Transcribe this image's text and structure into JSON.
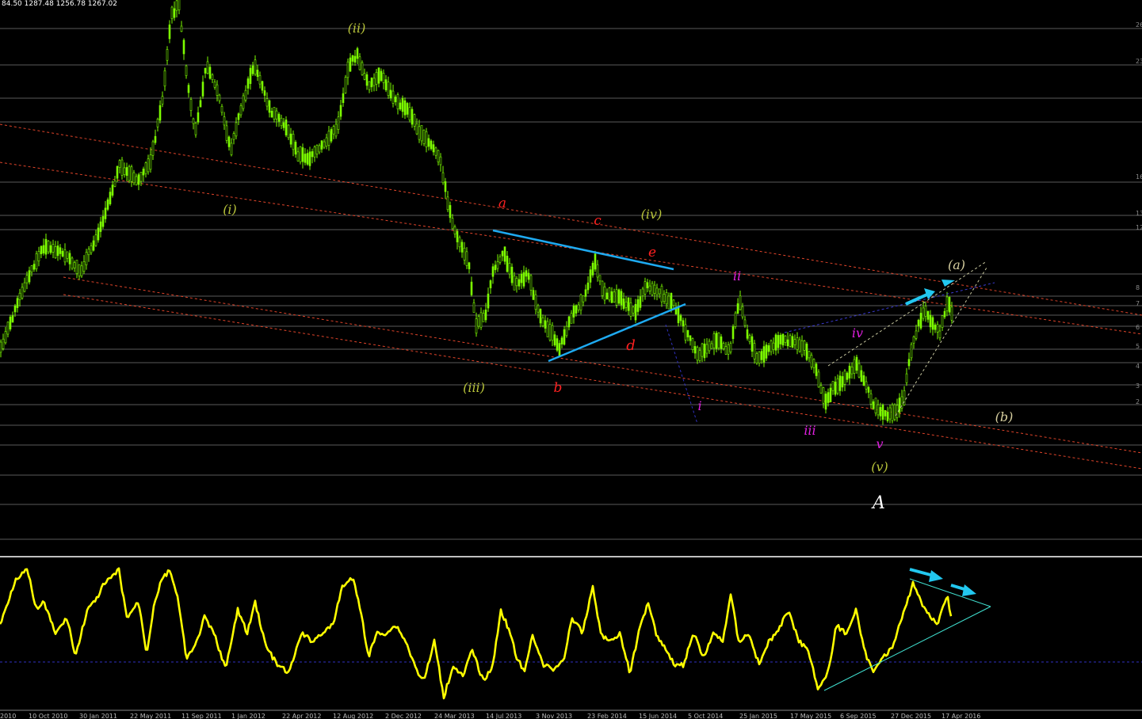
{
  "ohlc_readout": "84.50 1287.48 1256.78 1267.02",
  "colors": {
    "background": "#000000",
    "candle": "#7CFC00",
    "oscillator": "#FFFF00",
    "channel": "#E0442A",
    "trendline": "#1EAAF1",
    "wave_olive": "#B8C43A",
    "wave_red": "#FF2020",
    "wave_magenta": "#E020E0",
    "wave_tan": "#D8D0A0",
    "wave_white": "#FFFFFF"
  },
  "chart_data": [
    {
      "type": "candlestick",
      "title": "",
      "x_ticks": [
        "2010",
        "10 Oct 2010",
        "30 Jan 2011",
        "22 May 2011",
        "11 Sep 2011",
        "1 Jan 2012",
        "22 Apr 2012",
        "12 Aug 2012",
        "2 Dec 2012",
        "24 Mar 2013",
        "14 Jul 2013",
        "3 Nov 2013",
        "23 Feb 2014",
        "15 Jun 2014",
        "5 Oct 2014",
        "25 Jan 2015",
        "17 May 2015",
        "6 Sep 2015",
        "27 Dec 2015",
        "17 Apr 2016"
      ],
      "y_tick_labels": [
        "26",
        "23",
        "16",
        "13",
        "12",
        "8",
        "7",
        "6",
        "5",
        "4",
        "3",
        "2"
      ],
      "path_anchors": [
        [
          0,
          440
        ],
        [
          30,
          360
        ],
        [
          55,
          310
        ],
        [
          80,
          320
        ],
        [
          100,
          345
        ],
        [
          125,
          290
        ],
        [
          150,
          210
        ],
        [
          175,
          230
        ],
        [
          190,
          200
        ],
        [
          205,
          120
        ],
        [
          215,
          20
        ],
        [
          225,
          5
        ],
        [
          235,
          100
        ],
        [
          245,
          170
        ],
        [
          260,
          80
        ],
        [
          275,
          120
        ],
        [
          290,
          190
        ],
        [
          300,
          150
        ],
        [
          320,
          80
        ],
        [
          340,
          140
        ],
        [
          360,
          160
        ],
        [
          375,
          195
        ],
        [
          390,
          200
        ],
        [
          410,
          180
        ],
        [
          425,
          160
        ],
        [
          440,
          80
        ],
        [
          450,
          70
        ],
        [
          465,
          110
        ],
        [
          480,
          95
        ],
        [
          500,
          130
        ],
        [
          515,
          140
        ],
        [
          530,
          170
        ],
        [
          545,
          185
        ],
        [
          555,
          205
        ],
        [
          565,
          260
        ],
        [
          575,
          300
        ],
        [
          590,
          330
        ],
        [
          600,
          410
        ],
        [
          612,
          395
        ],
        [
          622,
          340
        ],
        [
          635,
          320
        ],
        [
          650,
          360
        ],
        [
          665,
          345
        ],
        [
          680,
          400
        ],
        [
          695,
          420
        ],
        [
          705,
          440
        ],
        [
          720,
          400
        ],
        [
          735,
          380
        ],
        [
          750,
          330
        ],
        [
          760,
          370
        ],
        [
          780,
          375
        ],
        [
          800,
          395
        ],
        [
          815,
          360
        ],
        [
          830,
          370
        ],
        [
          850,
          385
        ],
        [
          865,
          420
        ],
        [
          880,
          450
        ],
        [
          890,
          440
        ],
        [
          905,
          430
        ],
        [
          920,
          445
        ],
        [
          932,
          375
        ],
        [
          942,
          420
        ],
        [
          955,
          455
        ],
        [
          970,
          440
        ],
        [
          985,
          430
        ],
        [
          1000,
          430
        ],
        [
          1015,
          440
        ],
        [
          1030,
          470
        ],
        [
          1040,
          510
        ],
        [
          1050,
          490
        ],
        [
          1065,
          480
        ],
        [
          1080,
          460
        ],
        [
          1090,
          480
        ],
        [
          1100,
          510
        ],
        [
          1115,
          525
        ],
        [
          1130,
          520
        ],
        [
          1140,
          500
        ],
        [
          1145,
          460
        ],
        [
          1155,
          420
        ],
        [
          1165,
          390
        ],
        [
          1175,
          410
        ],
        [
          1185,
          420
        ],
        [
          1195,
          380
        ],
        [
          1200,
          395
        ]
      ]
    },
    {
      "type": "line",
      "title": "",
      "oscillator_anchors": [
        [
          0,
          790
        ],
        [
          20,
          730
        ],
        [
          35,
          720
        ],
        [
          45,
          770
        ],
        [
          55,
          760
        ],
        [
          70,
          800
        ],
        [
          85,
          780
        ],
        [
          95,
          830
        ],
        [
          110,
          770
        ],
        [
          120,
          760
        ],
        [
          130,
          740
        ],
        [
          140,
          730
        ],
        [
          150,
          720
        ],
        [
          160,
          780
        ],
        [
          175,
          760
        ],
        [
          185,
          825
        ],
        [
          195,
          760
        ],
        [
          205,
          730
        ],
        [
          215,
          720
        ],
        [
          225,
          760
        ],
        [
          235,
          830
        ],
        [
          245,
          820
        ],
        [
          258,
          780
        ],
        [
          270,
          800
        ],
        [
          285,
          845
        ],
        [
          300,
          770
        ],
        [
          312,
          800
        ],
        [
          322,
          760
        ],
        [
          335,
          815
        ],
        [
          350,
          840
        ],
        [
          365,
          850
        ],
        [
          380,
          800
        ],
        [
          395,
          810
        ],
        [
          405,
          800
        ],
        [
          420,
          790
        ],
        [
          432,
          740
        ],
        [
          445,
          730
        ],
        [
          455,
          770
        ],
        [
          465,
          830
        ],
        [
          475,
          800
        ],
        [
          485,
          800
        ],
        [
          500,
          790
        ],
        [
          512,
          810
        ],
        [
          525,
          845
        ],
        [
          535,
          860
        ],
        [
          548,
          810
        ],
        [
          560,
          880
        ],
        [
          572,
          840
        ],
        [
          585,
          855
        ],
        [
          595,
          820
        ],
        [
          610,
          860
        ],
        [
          622,
          840
        ],
        [
          632,
          770
        ],
        [
          642,
          795
        ],
        [
          652,
          830
        ],
        [
          662,
          850
        ],
        [
          672,
          800
        ],
        [
          685,
          840
        ],
        [
          700,
          845
        ],
        [
          712,
          830
        ],
        [
          722,
          780
        ],
        [
          735,
          800
        ],
        [
          748,
          740
        ],
        [
          758,
          800
        ],
        [
          768,
          810
        ],
        [
          782,
          800
        ],
        [
          795,
          850
        ],
        [
          808,
          790
        ],
        [
          818,
          760
        ],
        [
          828,
          800
        ],
        [
          840,
          820
        ],
        [
          852,
          840
        ],
        [
          862,
          840
        ],
        [
          875,
          800
        ],
        [
          888,
          830
        ],
        [
          900,
          800
        ],
        [
          912,
          810
        ],
        [
          922,
          750
        ],
        [
          932,
          810
        ],
        [
          945,
          800
        ],
        [
          958,
          840
        ],
        [
          970,
          810
        ],
        [
          980,
          800
        ],
        [
          995,
          770
        ],
        [
          1008,
          810
        ],
        [
          1020,
          820
        ],
        [
          1032,
          870
        ],
        [
          1045,
          850
        ],
        [
          1055,
          790
        ],
        [
          1068,
          800
        ],
        [
          1080,
          770
        ],
        [
          1090,
          820
        ],
        [
          1102,
          850
        ],
        [
          1112,
          830
        ],
        [
          1125,
          820
        ],
        [
          1135,
          790
        ],
        [
          1145,
          760
        ],
        [
          1152,
          735
        ],
        [
          1162,
          760
        ],
        [
          1172,
          775
        ],
        [
          1182,
          790
        ],
        [
          1195,
          750
        ],
        [
          1200,
          780
        ]
      ]
    }
  ],
  "wave_labels": [
    {
      "text": "(i)",
      "color": "wave_olive"
    },
    {
      "text": "(ii)",
      "color": "wave_olive"
    },
    {
      "text": "(iii)",
      "color": "wave_olive"
    },
    {
      "text": "(iv)",
      "color": "wave_olive"
    },
    {
      "text": "(v)",
      "color": "wave_olive"
    },
    {
      "text": "a",
      "color": "wave_red"
    },
    {
      "text": "b",
      "color": "wave_red"
    },
    {
      "text": "c",
      "color": "wave_red"
    },
    {
      "text": "d",
      "color": "wave_red"
    },
    {
      "text": "e",
      "color": "wave_red"
    },
    {
      "text": "i",
      "color": "wave_magenta"
    },
    {
      "text": "ii",
      "color": "wave_magenta"
    },
    {
      "text": "iii",
      "color": "wave_magenta"
    },
    {
      "text": "iv",
      "color": "wave_magenta"
    },
    {
      "text": "v",
      "color": "wave_magenta"
    },
    {
      "text": "(a)",
      "color": "wave_tan"
    },
    {
      "text": "(b)",
      "color": "wave_tan"
    },
    {
      "text": "A",
      "color": "wave_white"
    }
  ]
}
